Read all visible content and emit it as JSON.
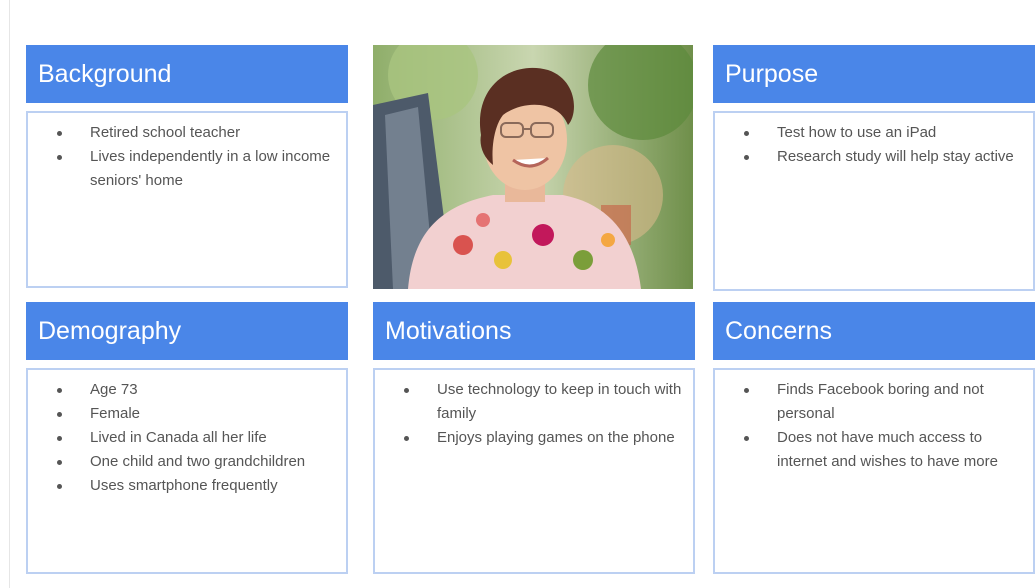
{
  "background": {
    "title": "Background",
    "items": [
      "Retired school teacher",
      "Lives independently in a low income seniors' home"
    ]
  },
  "purpose": {
    "title": "Purpose",
    "items": [
      "Test how to use an iPad",
      "Research study will help stay active"
    ]
  },
  "demography": {
    "title": "Demography",
    "items": [
      "Age 73",
      "Female",
      "Lived in Canada all her life",
      "One child and two grandchildren",
      "Uses smartphone frequently"
    ]
  },
  "motivations": {
    "title": "Motivations",
    "items": [
      "Use technology to keep in touch with family",
      "Enjoys playing games on the phone"
    ]
  },
  "concerns": {
    "title": "Concerns",
    "items": [
      "Finds Facebook boring and not personal",
      "Does not have much access to internet and wishes to have more"
    ]
  },
  "colors": {
    "header_blue": "#4a86e8",
    "box_border": "#bcd0f2",
    "text": "#555555"
  }
}
